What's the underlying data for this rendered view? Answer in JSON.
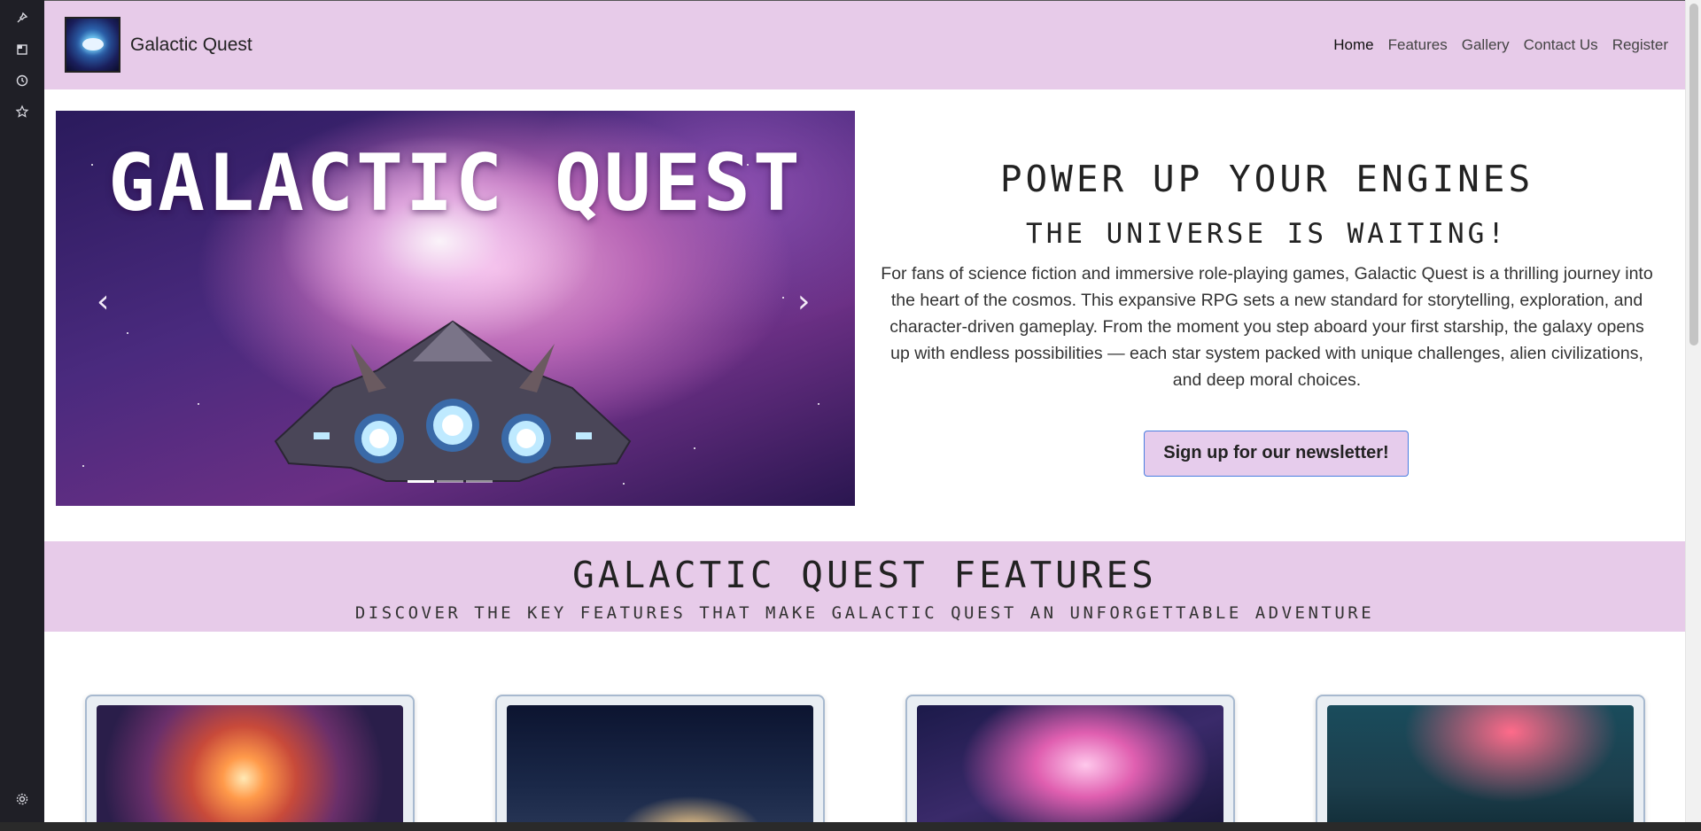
{
  "sidebar": {
    "icons": [
      "pin-icon",
      "tab-icon",
      "history-icon",
      "star-icon",
      "settings-icon"
    ]
  },
  "nav": {
    "brand": "Galactic Quest",
    "links": [
      "Home",
      "Features",
      "Gallery",
      "Contact Us",
      "Register"
    ],
    "active": "Home"
  },
  "hero": {
    "carousel_title": "GALACTIC QUEST",
    "prev_glyph": "‹",
    "next_glyph": "›",
    "indicator_count": 3,
    "active_indicator": 1,
    "heading": "POWER UP YOUR ENGINES",
    "subheading": "THE UNIVERSE IS WAITING!",
    "paragraph": "For fans of science fiction and immersive role-playing games, Galactic Quest is a thrilling journey into the heart of the cosmos. This expansive RPG sets a new standard for storytelling, exploration, and character-driven gameplay. From the moment you step aboard your first starship, the galaxy opens up with endless possibilities — each star system packed with unique challenges, alien civilizations, and deep moral choices.",
    "cta_label": "Sign up for our newsletter!"
  },
  "features": {
    "title": "GALACTIC QUEST FEATURES",
    "subtitle": "DISCOVER THE KEY FEATURES THAT MAKE GALACTIC QUEST AN UNFORGETTABLE ADVENTURE"
  },
  "colors": {
    "nav_bg": "#e7cbe9",
    "band_bg": "#e7cbe9",
    "cta_border": "#4a7ee0",
    "sidebar_bg": "#1f1f26"
  }
}
